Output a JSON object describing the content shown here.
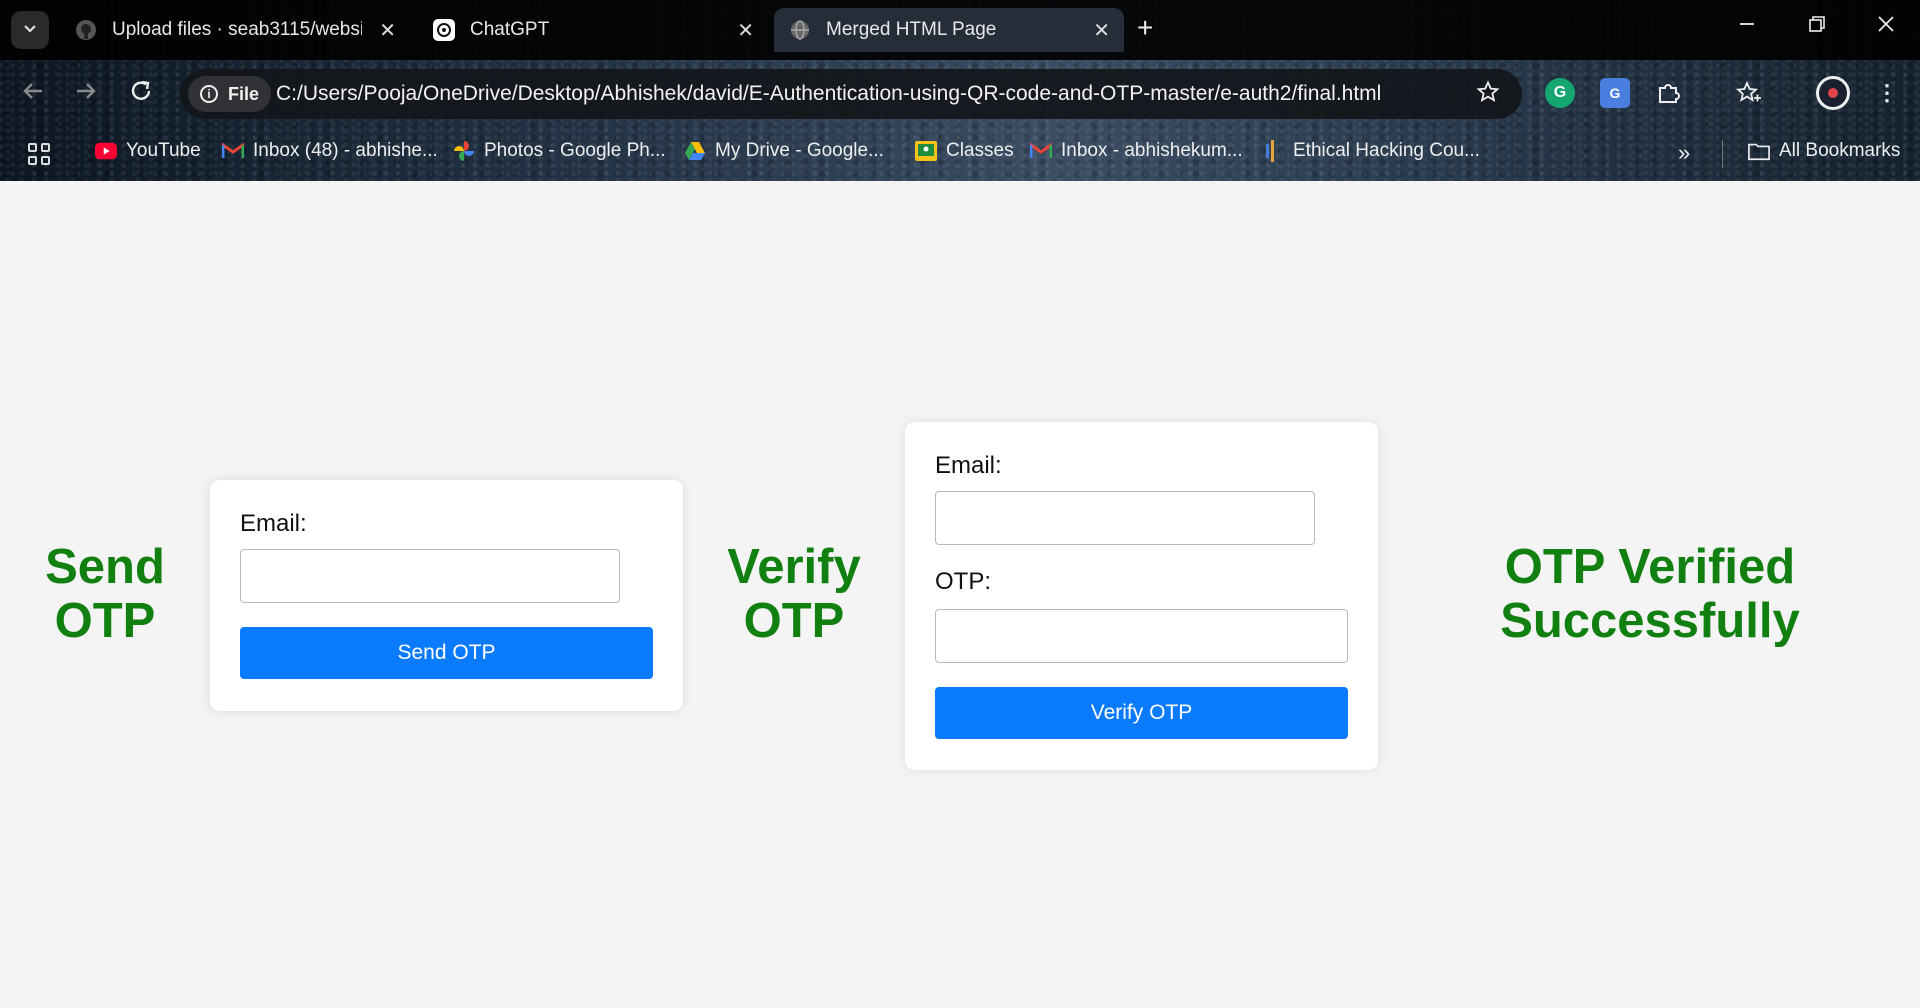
{
  "browser": {
    "tabs": [
      {
        "title": "Upload files · seab3115/website",
        "favicon": "github-icon",
        "active": false
      },
      {
        "title": "ChatGPT",
        "favicon": "chatgpt-icon",
        "active": false
      },
      {
        "title": "Merged HTML Page",
        "favicon": "globe-icon",
        "active": true
      }
    ],
    "site_chip_label": "File",
    "url": "C:/Users/Pooja/OneDrive/Desktop/Abhishek/david/E-Authentication-using-QR-code-and-OTP-master/e-auth2/final.html",
    "bookmarks": [
      {
        "label": "YouTube",
        "icon": "youtube-icon"
      },
      {
        "label": "Inbox (48) - abhishe...",
        "icon": "gmail-icon"
      },
      {
        "label": "Photos - Google Ph...",
        "icon": "google-photos-icon"
      },
      {
        "label": "My Drive - Google...",
        "icon": "google-drive-icon"
      },
      {
        "label": "Classes",
        "icon": "google-classroom-icon"
      },
      {
        "label": "Inbox - abhishekum...",
        "icon": "gmail-icon"
      },
      {
        "label": "Ethical Hacking Cou...",
        "icon": "bookmark-site-icon"
      }
    ],
    "all_bookmarks_label": "All Bookmarks",
    "accent_color": "#0a7bff"
  },
  "page": {
    "send_heading_line1": "Send",
    "send_heading_line2": "OTP",
    "send_form": {
      "email_label": "Email:",
      "email_value": "",
      "button_label": "Send OTP"
    },
    "verify_heading_line1": "Verify",
    "verify_heading_line2": "OTP",
    "verify_form": {
      "email_label": "Email:",
      "email_value": "",
      "otp_label": "OTP:",
      "otp_value": "",
      "button_label": "Verify OTP"
    },
    "success_line1": "OTP Verified",
    "success_line2": "Successfully",
    "heading_color": "#118011",
    "button_color": "#0a7bff"
  }
}
